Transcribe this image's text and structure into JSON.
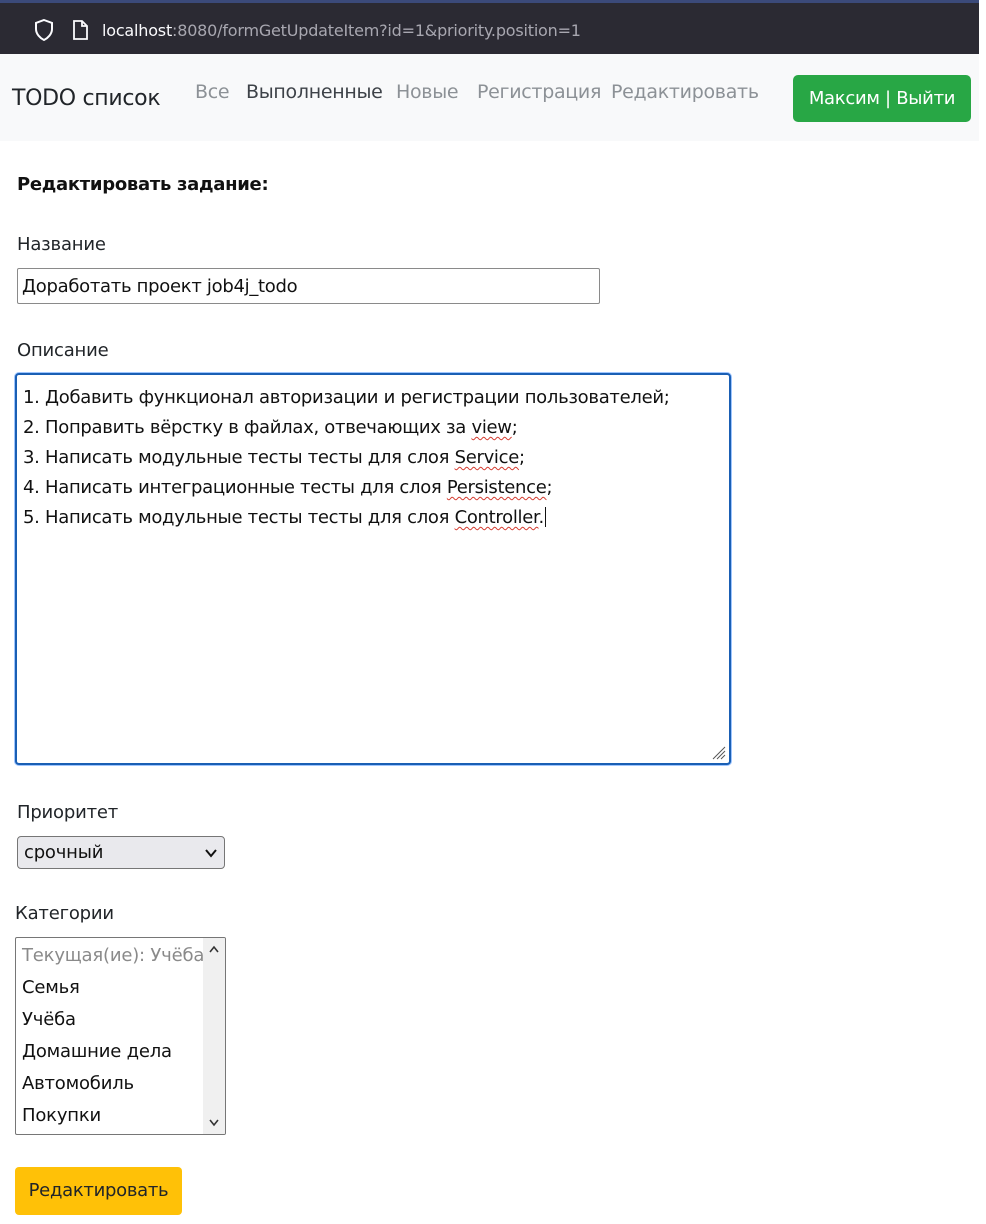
{
  "browser": {
    "url_host": "localhost",
    "url_rest": ":8080/formGetUpdateItem?id=1&priority.position=1"
  },
  "navbar": {
    "brand": "TODO список",
    "links": [
      {
        "label": "Все"
      },
      {
        "label": "Выполненные"
      },
      {
        "label": "Новые"
      },
      {
        "label": "Регистрация"
      },
      {
        "label": "Редактировать"
      }
    ],
    "user_button": "Максим | Выйти"
  },
  "form": {
    "heading": "Редактировать задание:",
    "title_label": "Название",
    "title_value": "Доработать проект job4j_todo",
    "description_label": "Описание",
    "description_lines": [
      {
        "before": "1. Добавить функционал авторизации и регистрации пользователей;",
        "word": "",
        "after": ""
      },
      {
        "before": "2. Поправить вёрстку в файлах, отвечающих за ",
        "word": "view",
        "after": ";"
      },
      {
        "before": "3. Написать модульные тесты тесты для слоя ",
        "word": "Service",
        "after": ";"
      },
      {
        "before": "4. Написать интеграционные тесты для слоя ",
        "word": "Persistence",
        "after": ";"
      },
      {
        "before": "5. Написать модульные тесты тесты для слоя ",
        "word": "Controller",
        "after": "."
      }
    ],
    "priority_label": "Приоритет",
    "priority_value": "срочный",
    "categories_label": "Категории",
    "categories": [
      "Текущая(ие): Учёба",
      "Семья",
      "Учёба",
      "Домашние дела",
      "Автомобиль",
      "Покупки"
    ],
    "submit_label": "Редактировать"
  },
  "colors": {
    "navbar_bg": "#f8f9fa",
    "logout_button": "#28a745",
    "submit_button": "#ffc107",
    "focus_border": "#1a5fb4"
  }
}
